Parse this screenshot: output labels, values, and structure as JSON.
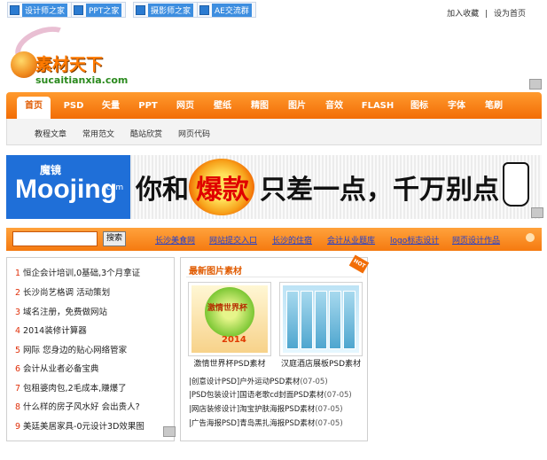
{
  "top_tabs": [
    {
      "label": "设计师之家"
    },
    {
      "label": "PPT之家"
    },
    {
      "label": "摄影师之家"
    },
    {
      "label": "AE交流群"
    }
  ],
  "top_links": {
    "bookmark": "加入收藏",
    "homepage": "设为首页"
  },
  "logo": {
    "cn": "素材天下",
    "en": "sucaitianxia.com"
  },
  "nav": {
    "items": [
      "首页",
      "PSD",
      "矢量",
      "PPT",
      "网页",
      "壁纸",
      "精图",
      "图片",
      "音效",
      "FLASH",
      "图标",
      "字体",
      "笔刷"
    ],
    "active_index": 0
  },
  "subnav": [
    "教程文章",
    "常用范文",
    "酷站欣赏",
    "网页代码"
  ],
  "banner": {
    "brand_cn": "魔镜",
    "brand_en": "Moojing",
    "brand_com": ".com",
    "text_a": "你和",
    "text_hot": "爆款",
    "text_b": "只差一点，千万别点"
  },
  "search": {
    "placeholder": "",
    "button": "搜索"
  },
  "quick_links": [
    "长沙美食网",
    "网站提交入口",
    "长沙的住宿",
    "会计从业题库",
    "logo标志设计",
    "网页设计作品"
  ],
  "left_list": [
    {
      "num": "1",
      "text": "恒企会计培训,0基础,3个月拿证"
    },
    {
      "num": "2",
      "text": "长沙尚艺格调 活动策划"
    },
    {
      "num": "3",
      "text": "域名注册，免费做网站"
    },
    {
      "num": "4",
      "text": "2014装修计算器"
    },
    {
      "num": "5",
      "text": "网际 您身边的贴心网络管家"
    },
    {
      "num": "6",
      "text": "会计从业者必备宝典"
    },
    {
      "num": "7",
      "text": "包租婆肉包,2毛成本,赚爆了"
    },
    {
      "num": "8",
      "text": "什么样的房子风水好 会出贵人?"
    },
    {
      "num": "9",
      "text": "美廷美居家具-0元设计3D效果图"
    }
  ],
  "materials": {
    "title": "最新图片素材",
    "hot_tag": "HOT",
    "thumb1_caption": "激情世界杯PSD素材",
    "thumb1_text": "激情世界杯",
    "thumb1_year": "2014",
    "thumb2_caption": "汉庭酒店展板PSD素材",
    "news": [
      {
        "text": "|创意设计PSD]户外运动PSD素材",
        "date": "(07-05)"
      },
      {
        "text": "|PSD包装设计]国语老歌cd封面PSD素材",
        "date": "(07-05)"
      },
      {
        "text": "|网店装修设计]淘宝护肤海报PSD素材",
        "date": "(07-05)"
      },
      {
        "text": "|广告海报PSD]青岛黑扎海报PSD素材",
        "date": "(07-05)"
      }
    ]
  }
}
